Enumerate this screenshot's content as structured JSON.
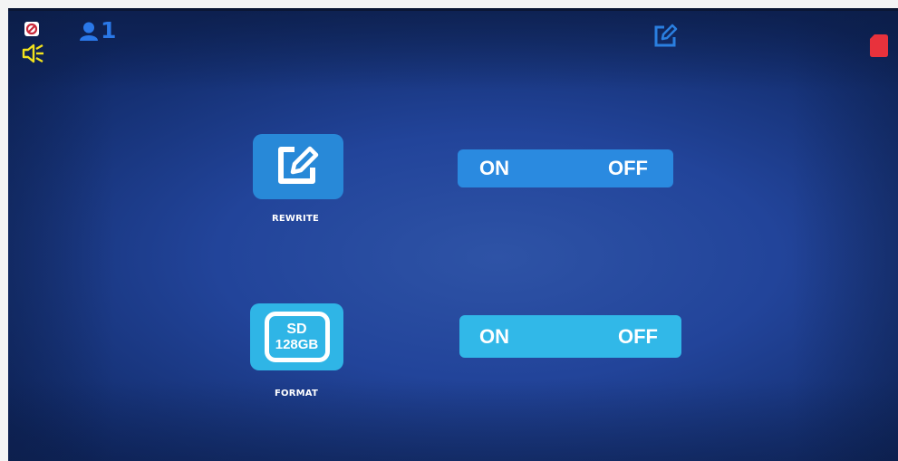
{
  "status_bar": {
    "icons": {
      "no_signal": "no-signal-icon",
      "speaker": "speaker-icon",
      "user": "user-icon",
      "rewrite_status": "rewrite-status-icon",
      "record": "record-icon"
    },
    "user_count": "1"
  },
  "settings": {
    "rewrite": {
      "label": "REWRITE",
      "icon": "edit-icon",
      "toggle": {
        "on_label": "ON",
        "off_label": "OFF"
      }
    },
    "format": {
      "label": "FORMAT",
      "sd_line1": "SD",
      "sd_line2": "128GB",
      "toggle": {
        "on_label": "ON",
        "off_label": "OFF"
      }
    }
  },
  "colors": {
    "background": "#22449a",
    "tile_rewrite": "#2889d8",
    "tile_format": "#2fb5e6",
    "toggle_rewrite": "#2a8ae0",
    "toggle_format": "#31b8e8",
    "user_icon": "#2a78e8",
    "speaker_icon": "#f2e21d",
    "record_icon": "#e8323c"
  }
}
